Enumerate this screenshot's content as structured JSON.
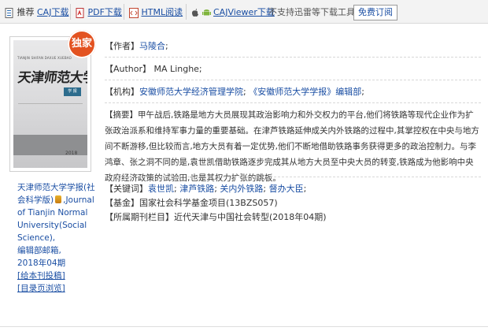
{
  "toolbar": {
    "recommend_prefix": "推荐",
    "caj_download": "CAJ下载",
    "pdf_download": "PDF下载",
    "html_read": "HTML阅读",
    "cajviewer_download": "CAJViewer下载",
    "notice": "不支持迅雷等下载工具。",
    "subscribe": "免费订阅"
  },
  "cover": {
    "badge": "独家",
    "title": "天津师范大学",
    "english": "TIANJIN SHIFAN DAXUE XUEBAO",
    "tag": "学 报",
    "year": "2018"
  },
  "journal": {
    "name_cn": "天津师范大学学报(社会科学版)",
    "name_en": ",Journal of Tianjin Normal University(Social Science),",
    "editorial": "编辑部邮箱,",
    "issue": "2018年04期",
    "submit": "[给本刊投稿]",
    "toc": "[目录页浏览]"
  },
  "meta": {
    "author_label": "【作者】",
    "author": "马陵合",
    "author_en_label": "【Author】",
    "author_en": "MA Linghe;",
    "org_label": "【机构】",
    "org1": "安徽师范大学经济管理学院",
    "org2": "《安徽师范大学学报》编辑部",
    "abstract_label": "【摘要】",
    "abstract": "甲午战后,铁路是地方大员展现其政治影响力和外交权力的平台,他们将铁路等现代企业作为扩张政治派系和维持军事力量的重要基础。在津芦铁路延伸成关内外铁路的过程中,其掌控权在中央与地方间不断游移,但比较而言,地方大员有着一定优势,他们不断地借助铁路事务获得更多的政治控制力。与李鸿章、张之洞不同的是,袁世凯借助铁路逐步完成其从地方大员至中央大员的转变,铁路成为他影响中央政府经济政策的试验田,也是其权力扩张的跳板。",
    "keywords_label": "【关键词】",
    "keywords": [
      "袁世凯",
      "津芦铁路",
      "关内外铁路",
      "督办大臣"
    ],
    "fund_label": "【基金】",
    "fund": "国家社会科学基金项目(13BZS057)",
    "column_label": "【所属期刊栏目】",
    "column": "近代天津与中国社会转型",
    "column_issue": "(2018年04期)"
  },
  "colors": {
    "link": "#1a4ea3",
    "badge": "#e35220",
    "toolbar_bg": "#f3f3f3"
  }
}
